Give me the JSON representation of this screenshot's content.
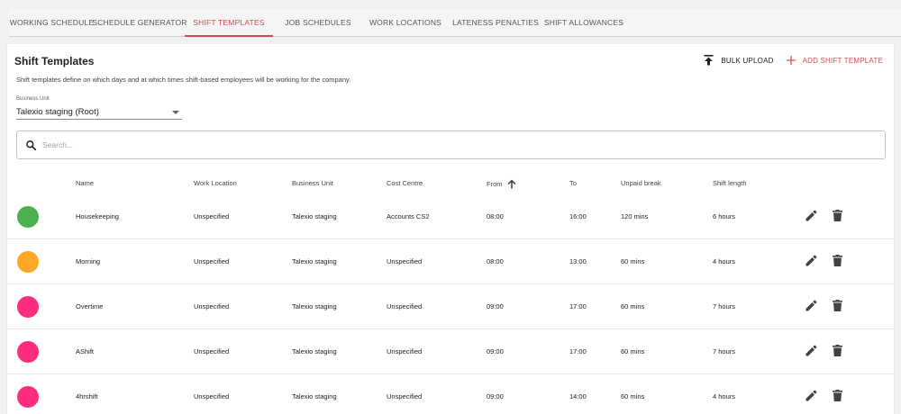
{
  "tabs": [
    {
      "label": "WORKING SCHEDULE",
      "active": false
    },
    {
      "label": "SCHEDULE GENERATOR",
      "active": false
    },
    {
      "label": "SHIFT TEMPLATES",
      "active": true
    },
    {
      "label": "JOB SCHEDULES",
      "active": false
    },
    {
      "label": "WORK LOCATIONS",
      "active": false
    },
    {
      "label": "LATENESS PENALTIES",
      "active": false
    },
    {
      "label": "SHIFT ALLOWANCES",
      "active": false
    }
  ],
  "page": {
    "title": "Shift Templates",
    "description": "Shift templates define on which days and at which times shift-based employees will be working for the company.",
    "bulk_upload_label": "BULK UPLOAD",
    "add_label": "ADD SHIFT TEMPLATE"
  },
  "business_unit": {
    "label": "Business Unit",
    "value": "Talexio staging (Root)"
  },
  "search": {
    "placeholder": "Search..."
  },
  "table": {
    "headers": {
      "name": "Name",
      "location": "Work Location",
      "unit": "Business Unit",
      "cost": "Cost Centre",
      "from": "From",
      "to": "To",
      "break": "Unpaid break",
      "length": "Shift length"
    },
    "rows": [
      {
        "color": "#4caf50",
        "name": "Housekeeping",
        "location": "Unspecified",
        "unit": "Talexio staging",
        "cost": "Accounts CS2",
        "from": "08:00",
        "to": "16:00",
        "break": "120 mins",
        "length": "6 hours"
      },
      {
        "color": "#ffa726",
        "name": "Morning",
        "location": "Unspecified",
        "unit": "Talexio staging",
        "cost": "Unspecified",
        "from": "08:00",
        "to": "13:00",
        "break": "60 mins",
        "length": "4 hours"
      },
      {
        "color": "#ff2d7e",
        "name": "Overtime",
        "location": "Unspecified",
        "unit": "Talexio staging",
        "cost": "Unspecified",
        "from": "09:00",
        "to": "17:00",
        "break": "60 mins",
        "length": "7 hours"
      },
      {
        "color": "#ff2d7e",
        "name": "AShift",
        "location": "Unspecified",
        "unit": "Talexio staging",
        "cost": "Unspecified",
        "from": "09:00",
        "to": "17:00",
        "break": "60 mins",
        "length": "7 hours"
      },
      {
        "color": "#ff2d7e",
        "name": "4hrshift",
        "location": "Unspecified",
        "unit": "Talexio staging",
        "cost": "Unspecified",
        "from": "09:00",
        "to": "14:00",
        "break": "60 mins",
        "length": "4 hours"
      }
    ]
  }
}
